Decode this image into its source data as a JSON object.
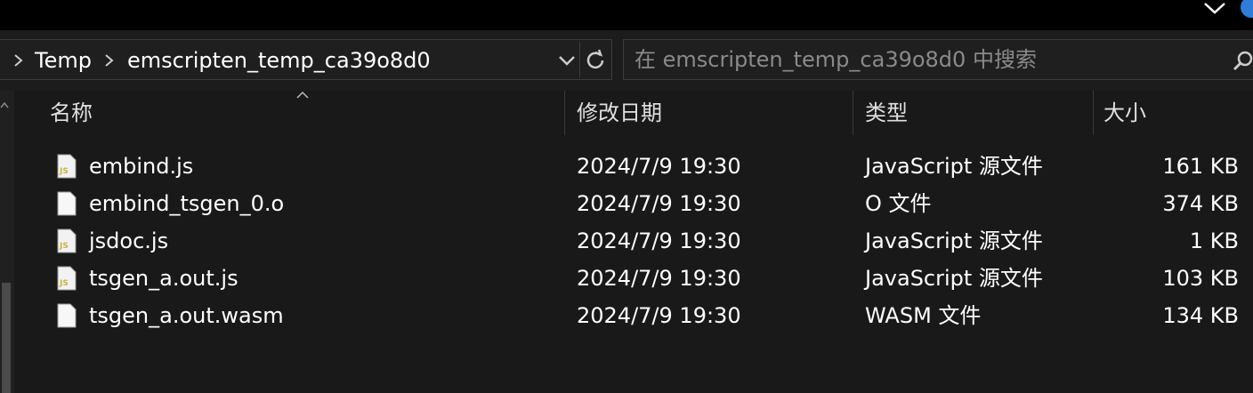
{
  "breadcrumbs": [
    "Temp",
    "emscripten_temp_ca39o8d0"
  ],
  "search": {
    "placeholder": "在 emscripten_temp_ca39o8d0 中搜索"
  },
  "columns": {
    "name": "名称",
    "modified": "修改日期",
    "type": "类型",
    "size": "大小"
  },
  "files": [
    {
      "name": "embind.js",
      "icon": "js-file-icon",
      "modified": "2024/7/9 19:30",
      "type": "JavaScript 源文件",
      "size": "161 KB"
    },
    {
      "name": "embind_tsgen_0.o",
      "icon": "blank-file-icon",
      "modified": "2024/7/9 19:30",
      "type": "O 文件",
      "size": "374 KB"
    },
    {
      "name": "jsdoc.js",
      "icon": "js-file-icon",
      "modified": "2024/7/9 19:30",
      "type": "JavaScript 源文件",
      "size": "1 KB"
    },
    {
      "name": "tsgen_a.out.js",
      "icon": "js-file-icon",
      "modified": "2024/7/9 19:30",
      "type": "JavaScript 源文件",
      "size": "103 KB"
    },
    {
      "name": "tsgen_a.out.wasm",
      "icon": "blank-file-icon",
      "modified": "2024/7/9 19:30",
      "type": "WASM 文件",
      "size": "134 KB"
    }
  ],
  "colors": {
    "background": "#191919",
    "js_badge": "#c8b43c",
    "accent": "#2f7dd8"
  }
}
